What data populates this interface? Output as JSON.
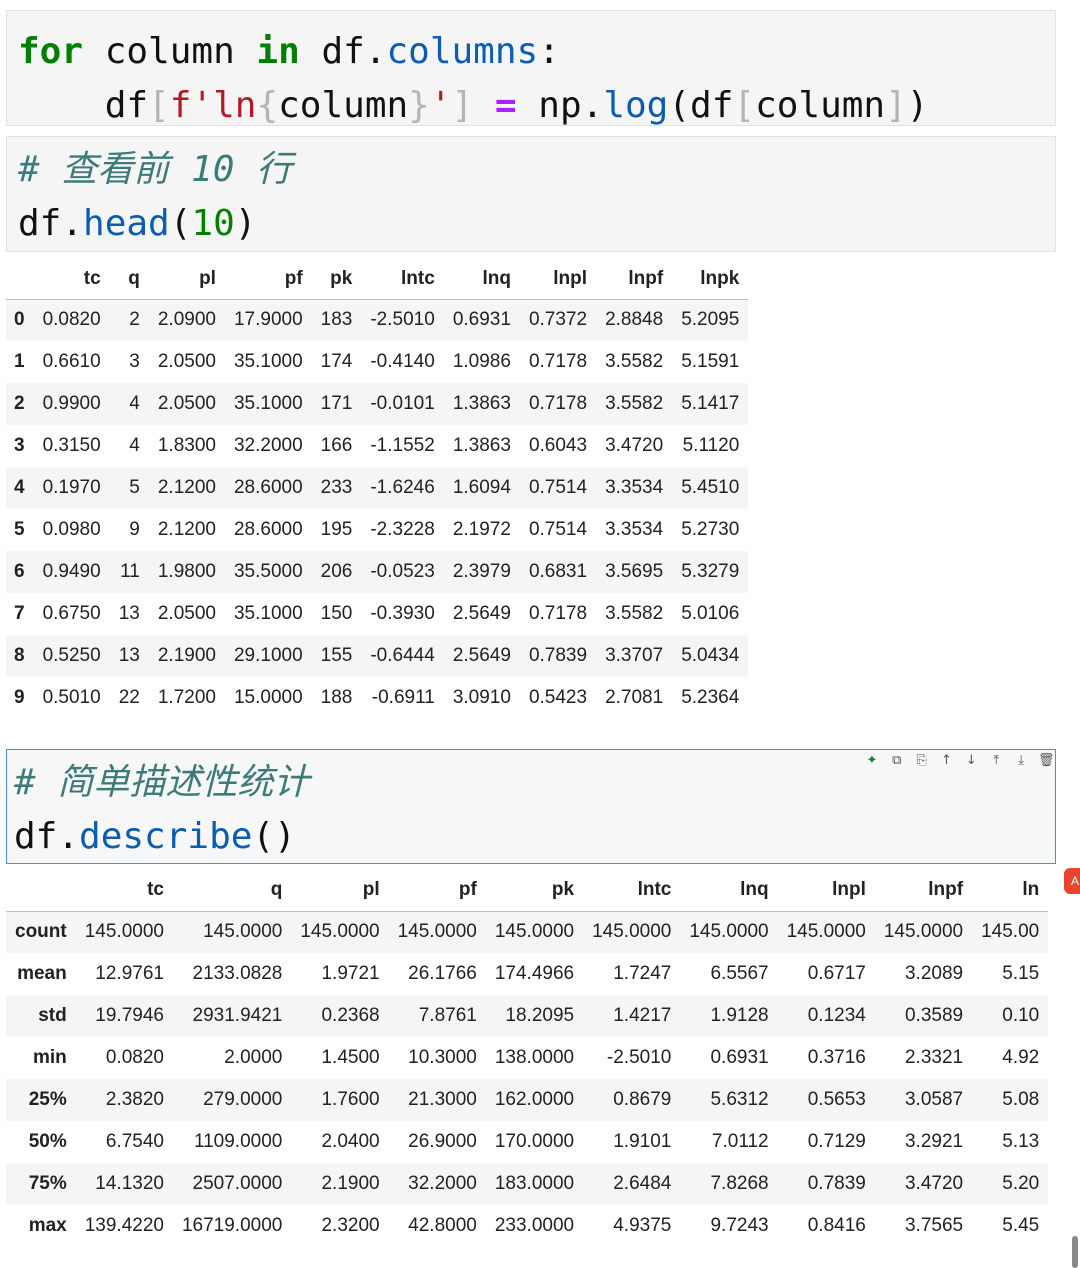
{
  "cells": [
    {
      "id": "cell-log-loop",
      "lines": [
        [
          {
            "t": "for",
            "c": "kw"
          },
          {
            "t": " column ",
            "c": ""
          },
          {
            "t": "in",
            "c": "kw"
          },
          {
            "t": " df.",
            "c": ""
          },
          {
            "t": "columns",
            "c": "attr"
          },
          {
            "t": ":",
            "c": ""
          }
        ],
        [
          {
            "t": "    df",
            "c": ""
          },
          {
            "t": "[",
            "c": "br"
          },
          {
            "t": "f'ln",
            "c": "str"
          },
          {
            "t": "{",
            "c": "br"
          },
          {
            "t": "column",
            "c": ""
          },
          {
            "t": "}",
            "c": "br"
          },
          {
            "t": "'",
            "c": "str"
          },
          {
            "t": "]",
            "c": "br"
          },
          {
            "t": " ",
            "c": ""
          },
          {
            "t": "=",
            "c": "op"
          },
          {
            "t": " np.",
            "c": ""
          },
          {
            "t": "log",
            "c": "attr"
          },
          {
            "t": "(df",
            "c": ""
          },
          {
            "t": "[",
            "c": "br"
          },
          {
            "t": "column",
            "c": ""
          },
          {
            "t": "]",
            "c": "br"
          },
          {
            "t": ")",
            "c": ""
          }
        ]
      ]
    },
    {
      "id": "cell-head",
      "lines": [
        [
          {
            "t": "# ",
            "c": "cm"
          },
          {
            "t": "查看前",
            "c": "cm cm-cjk"
          },
          {
            "t": " 10 ",
            "c": "cm"
          },
          {
            "t": "行",
            "c": "cm cm-cjk"
          }
        ],
        [
          {
            "t": "df.",
            "c": ""
          },
          {
            "t": "head",
            "c": "attr"
          },
          {
            "t": "(",
            "c": ""
          },
          {
            "t": "10",
            "c": "num"
          },
          {
            "t": ")",
            "c": ""
          }
        ]
      ]
    },
    {
      "id": "cell-describe",
      "lines": [
        [
          {
            "t": "# ",
            "c": "cm"
          },
          {
            "t": "简单描述性统计",
            "c": "cm cm-cjk"
          }
        ],
        [
          {
            "t": "df.",
            "c": ""
          },
          {
            "t": "describe",
            "c": "attr"
          },
          {
            "t": "()",
            "c": ""
          }
        ]
      ]
    }
  ],
  "head_table": {
    "columns": [
      "",
      "tc",
      "q",
      "pl",
      "pf",
      "pk",
      "lntc",
      "lnq",
      "lnpl",
      "lnpf",
      "lnpk"
    ],
    "rows": [
      [
        "0",
        "0.0820",
        "2",
        "2.0900",
        "17.9000",
        "183",
        "-2.5010",
        "0.6931",
        "0.7372",
        "2.8848",
        "5.2095"
      ],
      [
        "1",
        "0.6610",
        "3",
        "2.0500",
        "35.1000",
        "174",
        "-0.4140",
        "1.0986",
        "0.7178",
        "3.5582",
        "5.1591"
      ],
      [
        "2",
        "0.9900",
        "4",
        "2.0500",
        "35.1000",
        "171",
        "-0.0101",
        "1.3863",
        "0.7178",
        "3.5582",
        "5.1417"
      ],
      [
        "3",
        "0.3150",
        "4",
        "1.8300",
        "32.2000",
        "166",
        "-1.1552",
        "1.3863",
        "0.6043",
        "3.4720",
        "5.1120"
      ],
      [
        "4",
        "0.1970",
        "5",
        "2.1200",
        "28.6000",
        "233",
        "-1.6246",
        "1.6094",
        "0.7514",
        "3.3534",
        "5.4510"
      ],
      [
        "5",
        "0.0980",
        "9",
        "2.1200",
        "28.6000",
        "195",
        "-2.3228",
        "2.1972",
        "0.7514",
        "3.3534",
        "5.2730"
      ],
      [
        "6",
        "0.9490",
        "11",
        "1.9800",
        "35.5000",
        "206",
        "-0.0523",
        "2.3979",
        "0.6831",
        "3.5695",
        "5.3279"
      ],
      [
        "7",
        "0.6750",
        "13",
        "2.0500",
        "35.1000",
        "150",
        "-0.3930",
        "2.5649",
        "0.7178",
        "3.5582",
        "5.0106"
      ],
      [
        "8",
        "0.5250",
        "13",
        "2.1900",
        "29.1000",
        "155",
        "-0.6444",
        "2.5649",
        "0.7839",
        "3.3707",
        "5.0434"
      ],
      [
        "9",
        "0.5010",
        "22",
        "1.7200",
        "15.0000",
        "188",
        "-0.6911",
        "3.0910",
        "0.5423",
        "2.7081",
        "5.2364"
      ]
    ]
  },
  "describe_table": {
    "columns": [
      "",
      "tc",
      "q",
      "pl",
      "pf",
      "pk",
      "lntc",
      "lnq",
      "lnpl",
      "lnpf",
      "ln"
    ],
    "rows": [
      [
        "count",
        "145.0000",
        "145.0000",
        "145.0000",
        "145.0000",
        "145.0000",
        "145.0000",
        "145.0000",
        "145.0000",
        "145.0000",
        "145.00"
      ],
      [
        "mean",
        "12.9761",
        "2133.0828",
        "1.9721",
        "26.1766",
        "174.4966",
        "1.7247",
        "6.5567",
        "0.6717",
        "3.2089",
        "5.15"
      ],
      [
        "std",
        "19.7946",
        "2931.9421",
        "0.2368",
        "7.8761",
        "18.2095",
        "1.4217",
        "1.9128",
        "0.1234",
        "0.3589",
        "0.10"
      ],
      [
        "min",
        "0.0820",
        "2.0000",
        "1.4500",
        "10.3000",
        "138.0000",
        "-2.5010",
        "0.6931",
        "0.3716",
        "2.3321",
        "4.92"
      ],
      [
        "25%",
        "2.3820",
        "279.0000",
        "1.7600",
        "21.3000",
        "162.0000",
        "0.8679",
        "5.6312",
        "0.5653",
        "3.0587",
        "5.08"
      ],
      [
        "50%",
        "6.7540",
        "1109.0000",
        "2.0400",
        "26.9000",
        "170.0000",
        "1.9101",
        "7.0112",
        "0.7129",
        "3.2921",
        "5.13"
      ],
      [
        "75%",
        "14.1320",
        "2507.0000",
        "2.1900",
        "32.2000",
        "183.0000",
        "2.6484",
        "7.8268",
        "0.7839",
        "3.4720",
        "5.20"
      ],
      [
        "max",
        "139.4220",
        "16719.0000",
        "2.3200",
        "42.8000",
        "233.0000",
        "4.9375",
        "9.7243",
        "0.8416",
        "3.7565",
        "5.45"
      ]
    ]
  },
  "toolbar": {
    "icons": [
      {
        "name": "sparkle-icon",
        "glyph": "✦"
      },
      {
        "name": "code-icon",
        "glyph": "⧉"
      },
      {
        "name": "copy-icon",
        "glyph": "⎘"
      },
      {
        "name": "arrow-up-icon",
        "glyph": "↑"
      },
      {
        "name": "arrow-down-icon",
        "glyph": "↓"
      },
      {
        "name": "insert-above-icon",
        "glyph": "⤒"
      },
      {
        "name": "insert-below-icon",
        "glyph": "⤓"
      },
      {
        "name": "delete-icon",
        "glyph": "🗑"
      }
    ]
  },
  "colors": {
    "accent_border": "#4a8fd4",
    "badge": "#e8452c"
  }
}
